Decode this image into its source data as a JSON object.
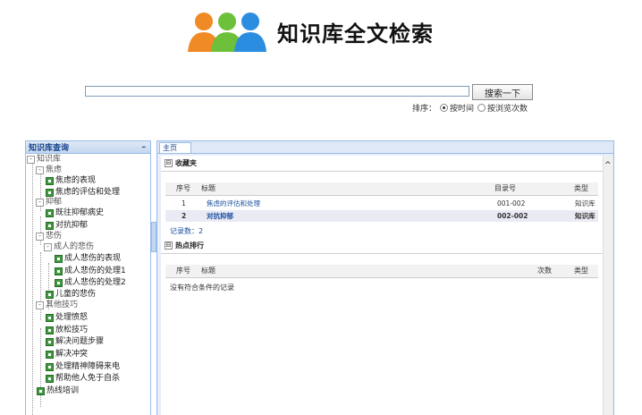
{
  "header": {
    "logo_icon": "people-group-icon",
    "title": "知识库全文检索"
  },
  "search": {
    "value": "",
    "placeholder": "",
    "button_label": "搜索一下"
  },
  "sort": {
    "label": "排序：",
    "options": [
      {
        "label": "按时间",
        "selected": true
      },
      {
        "label": "按浏览次数",
        "selected": false
      }
    ]
  },
  "sidebar": {
    "title": "知识库查询",
    "collapse_label": "–",
    "tree": [
      {
        "label": "知识库",
        "type": "folder",
        "toggle": "-"
      },
      {
        "label": "焦虑",
        "type": "folder",
        "toggle": "-"
      },
      {
        "label": "焦虑的表现",
        "type": "doc"
      },
      {
        "label": "焦虑的评估和处理",
        "type": "doc"
      },
      {
        "label": "抑郁",
        "type": "folder",
        "toggle": "-"
      },
      {
        "label": "既往抑郁病史",
        "type": "doc"
      },
      {
        "label": "对抗抑郁",
        "type": "doc"
      },
      {
        "label": "悲伤",
        "type": "folder",
        "toggle": "-"
      },
      {
        "label": "成人的悲伤",
        "type": "folder",
        "toggle": "-"
      },
      {
        "label": "成人悲伤的表现",
        "type": "doc"
      },
      {
        "label": "成人悲伤的处理1",
        "type": "doc"
      },
      {
        "label": "成人悲伤的处理2",
        "type": "doc"
      },
      {
        "label": "儿童的悲伤",
        "type": "doc"
      },
      {
        "label": "其他技巧",
        "type": "folder",
        "toggle": "-"
      },
      {
        "label": "处理愤怒",
        "type": "doc"
      },
      {
        "label": "放松技巧",
        "type": "doc"
      },
      {
        "label": "解决问题步骤",
        "type": "doc"
      },
      {
        "label": "解决冲突",
        "type": "doc"
      },
      {
        "label": "处理精神障碍来电",
        "type": "doc"
      },
      {
        "label": "帮助他人免于自杀",
        "type": "doc"
      },
      {
        "label": "热线培训",
        "type": "doc"
      }
    ]
  },
  "main": {
    "tab_label": "主页",
    "favorites": {
      "title": "收藏夹",
      "toggle": "⊟",
      "columns": [
        "序号",
        "标题",
        "目录号",
        "类型"
      ],
      "rows": [
        {
          "no": "1",
          "title": "焦虑的评估和处理",
          "code": "001-002",
          "type": "知识库"
        },
        {
          "no": "2",
          "title": "对抗抑郁",
          "code": "002-002",
          "type": "知识库"
        }
      ],
      "count_text": "记录数：2"
    },
    "hot": {
      "title": "热点排行",
      "toggle": "⊟",
      "columns": [
        "序号",
        "标题",
        "次数",
        "类型"
      ],
      "empty_text": "没有符合条件的记录"
    },
    "scroll_up": "^"
  }
}
